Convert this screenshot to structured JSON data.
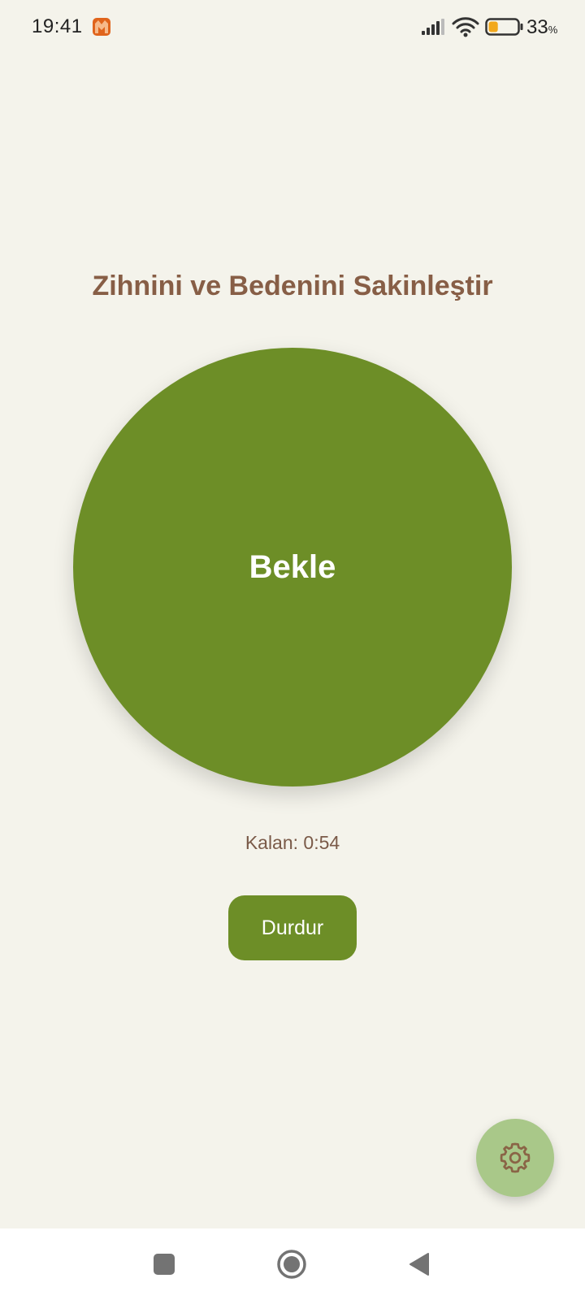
{
  "status_bar": {
    "time": "19:41",
    "battery_percent": "33",
    "battery_unit": "%",
    "battery_level": 0.33,
    "icons": [
      "app-notification-icon",
      "cellular-signal-icon",
      "wifi-icon",
      "battery-icon"
    ]
  },
  "main": {
    "title": "Zihnini ve Bedenini Sakinleştir",
    "phase": "Bekle",
    "remaining": "Kalan: 0:54",
    "stop_label": "Durdur"
  },
  "fab": {
    "icon": "gear-icon"
  },
  "nav_bar": {
    "icons": [
      "recents-square-icon",
      "home-circle-icon",
      "back-triangle-icon"
    ]
  },
  "colors": {
    "background": "#f4f3eb",
    "primary_green": "#6d8e27",
    "title_brown": "#875e46",
    "fab_green": "#a9c889"
  }
}
